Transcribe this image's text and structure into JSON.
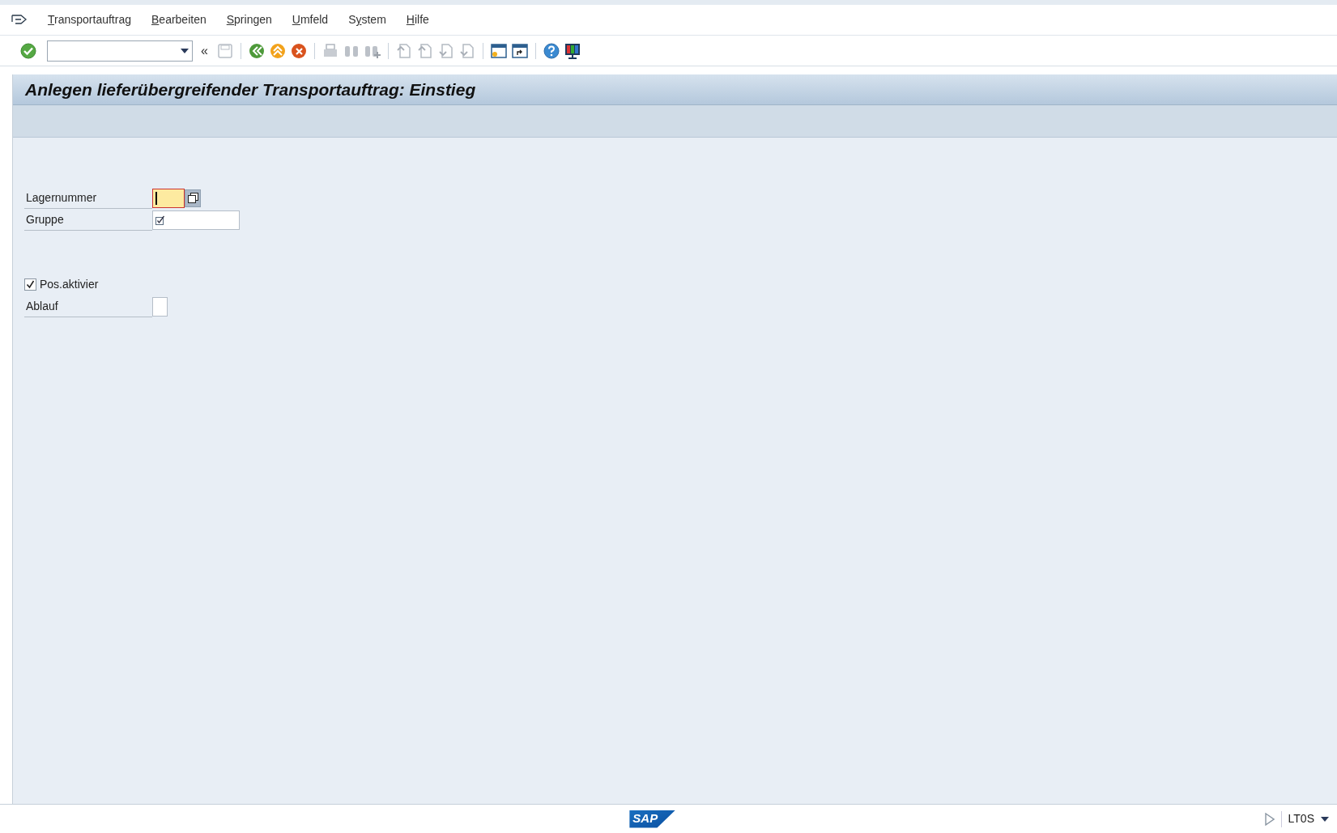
{
  "menu_bar": {
    "items": [
      {
        "accelerator": "T",
        "after": "ransportauftrag"
      },
      {
        "accelerator": "B",
        "after": "earbeiten"
      },
      {
        "accelerator": "S",
        "after": "pringen"
      },
      {
        "accelerator": "U",
        "after": "mfeld"
      },
      {
        "before": "S",
        "accelerator": "y",
        "after": "stem"
      },
      {
        "accelerator": "H",
        "after": "ilfe"
      }
    ]
  },
  "toolbar": {
    "history_arrow": "«"
  },
  "title": "Anlegen lieferübergreifender Transportauftrag: Einstieg",
  "form": {
    "fields": [
      {
        "kind": "input_short",
        "label": "Lagernummer",
        "focused": true,
        "has_search_help": true,
        "required": false
      },
      {
        "kind": "input_long",
        "label": "Gruppe",
        "focused": false,
        "has_search_help": false,
        "required": true
      },
      {
        "kind": "spacer"
      },
      {
        "kind": "checkbox",
        "label": "Pos.aktivier",
        "checked": true
      },
      {
        "kind": "input_tiny",
        "label": "Ablauf",
        "focused": false,
        "has_search_help": false,
        "required": false
      }
    ]
  },
  "status_bar": {
    "logo_text": "SAP",
    "transaction": "LT0S"
  }
}
